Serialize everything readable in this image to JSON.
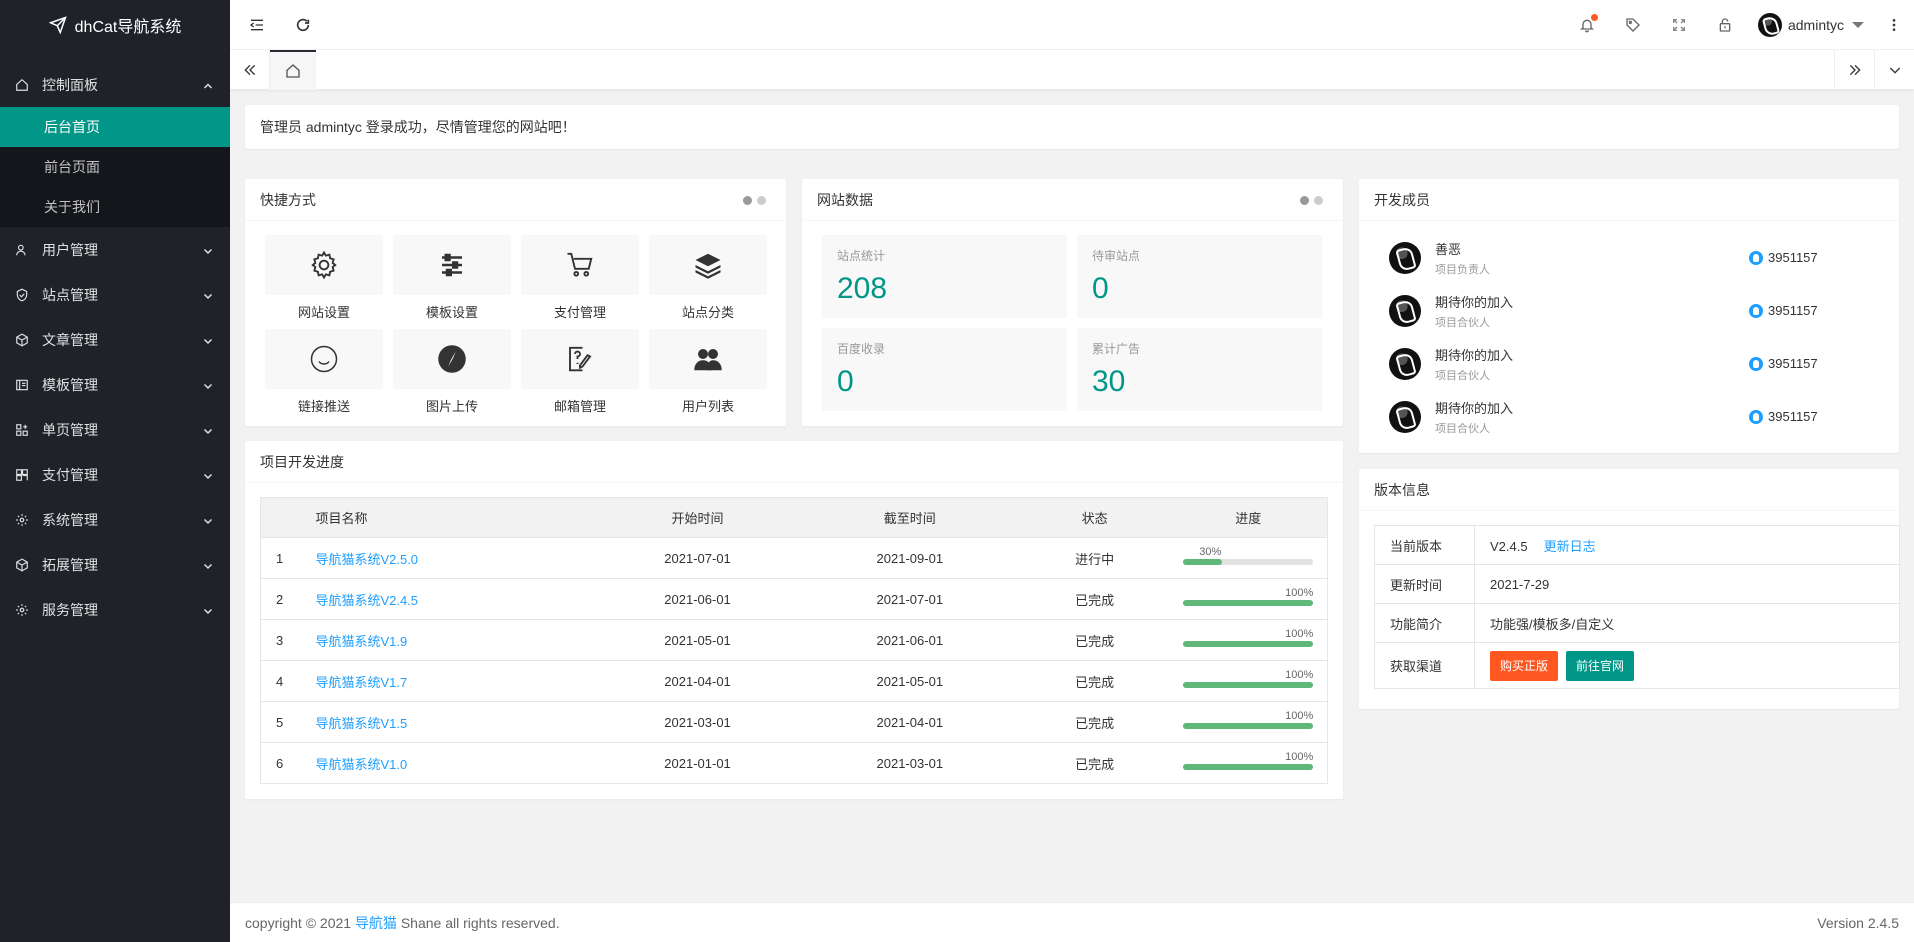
{
  "app": {
    "title": "dhCat导航系统"
  },
  "sidebar": {
    "items": [
      {
        "label": "控制面板",
        "expanded": true,
        "icon": "home-icon"
      },
      {
        "label": "用户管理",
        "icon": "user-icon"
      },
      {
        "label": "站点管理",
        "icon": "shield-icon"
      },
      {
        "label": "文章管理",
        "icon": "cube-icon"
      },
      {
        "label": "模板管理",
        "icon": "template-icon"
      },
      {
        "label": "单页管理",
        "icon": "apps-icon"
      },
      {
        "label": "支付管理",
        "icon": "grid-icon"
      },
      {
        "label": "系统管理",
        "icon": "gear-icon"
      },
      {
        "label": "拓展管理",
        "icon": "cube-icon"
      },
      {
        "label": "服务管理",
        "icon": "gear-icon"
      }
    ],
    "sub_items": [
      {
        "label": "后台首页",
        "active": true
      },
      {
        "label": "前台页面"
      },
      {
        "label": "关于我们"
      }
    ]
  },
  "header": {
    "username": "admintyc",
    "notification_dot_color": "#ff5722"
  },
  "notice": {
    "text": "管理员 admintyc 登录成功，尽情管理您的网站吧！"
  },
  "quick": {
    "title": "快捷方式",
    "items": [
      {
        "label": "网站设置",
        "icon": "gear-icon"
      },
      {
        "label": "模板设置",
        "icon": "sliders-icon"
      },
      {
        "label": "支付管理",
        "icon": "cart-icon"
      },
      {
        "label": "站点分类",
        "icon": "layers-icon"
      },
      {
        "label": "链接推送",
        "icon": "smile-icon"
      },
      {
        "label": "图片上传",
        "icon": "compass-icon"
      },
      {
        "label": "邮箱管理",
        "icon": "edit-doc-icon"
      },
      {
        "label": "用户列表",
        "icon": "users-icon"
      }
    ]
  },
  "site_data": {
    "title": "网站数据",
    "stats": [
      {
        "label": "站点统计",
        "value": "208"
      },
      {
        "label": "待审站点",
        "value": "0"
      },
      {
        "label": "百度收录",
        "value": "0"
      },
      {
        "label": "累计广告",
        "value": "30"
      }
    ]
  },
  "members": {
    "title": "开发成员",
    "list": [
      {
        "name": "善恶",
        "role": "项目负责人",
        "qq": "3951157"
      },
      {
        "name": "期待你的加入",
        "role": "项目合伙人",
        "qq": "3951157"
      },
      {
        "name": "期待你的加入",
        "role": "项目合伙人",
        "qq": "3951157"
      },
      {
        "name": "期待你的加入",
        "role": "项目合伙人",
        "qq": "3951157"
      }
    ]
  },
  "projects": {
    "title": "项目开发进度",
    "columns": [
      "项目名称",
      "开始时间",
      "截至时间",
      "状态",
      "进度"
    ],
    "rows": [
      {
        "idx": "1",
        "name": "导航猫系统V2.5.0",
        "start": "2021-07-01",
        "end": "2021-09-01",
        "status": "进行中",
        "progress": 30,
        "progress_text": "30%"
      },
      {
        "idx": "2",
        "name": "导航猫系统V2.4.5",
        "start": "2021-06-01",
        "end": "2021-07-01",
        "status": "已完成",
        "progress": 100,
        "progress_text": "100%"
      },
      {
        "idx": "3",
        "name": "导航猫系统V1.9",
        "start": "2021-05-01",
        "end": "2021-06-01",
        "status": "已完成",
        "progress": 100,
        "progress_text": "100%"
      },
      {
        "idx": "4",
        "name": "导航猫系统V1.7",
        "start": "2021-04-01",
        "end": "2021-05-01",
        "status": "已完成",
        "progress": 100,
        "progress_text": "100%"
      },
      {
        "idx": "5",
        "name": "导航猫系统V1.5",
        "start": "2021-03-01",
        "end": "2021-04-01",
        "status": "已完成",
        "progress": 100,
        "progress_text": "100%"
      },
      {
        "idx": "6",
        "name": "导航猫系统V1.0",
        "start": "2021-01-01",
        "end": "2021-03-01",
        "status": "已完成",
        "progress": 100,
        "progress_text": "100%"
      }
    ]
  },
  "version": {
    "title": "版本信息",
    "current_label": "当前版本",
    "current_value": "V2.4.5",
    "changelog_link": "更新日志",
    "update_label": "更新时间",
    "update_value": "2021-7-29",
    "intro_label": "功能简介",
    "intro_value": "功能强/模板多/自定义",
    "channel_label": "获取渠道",
    "buy_button": "购买正版",
    "site_button": "前往官网"
  },
  "footer": {
    "prefix": "copyright © 2021 ",
    "brand": "导航猫",
    "suffix": " Shane all rights reserved.",
    "version": "Version 2.4.5"
  }
}
